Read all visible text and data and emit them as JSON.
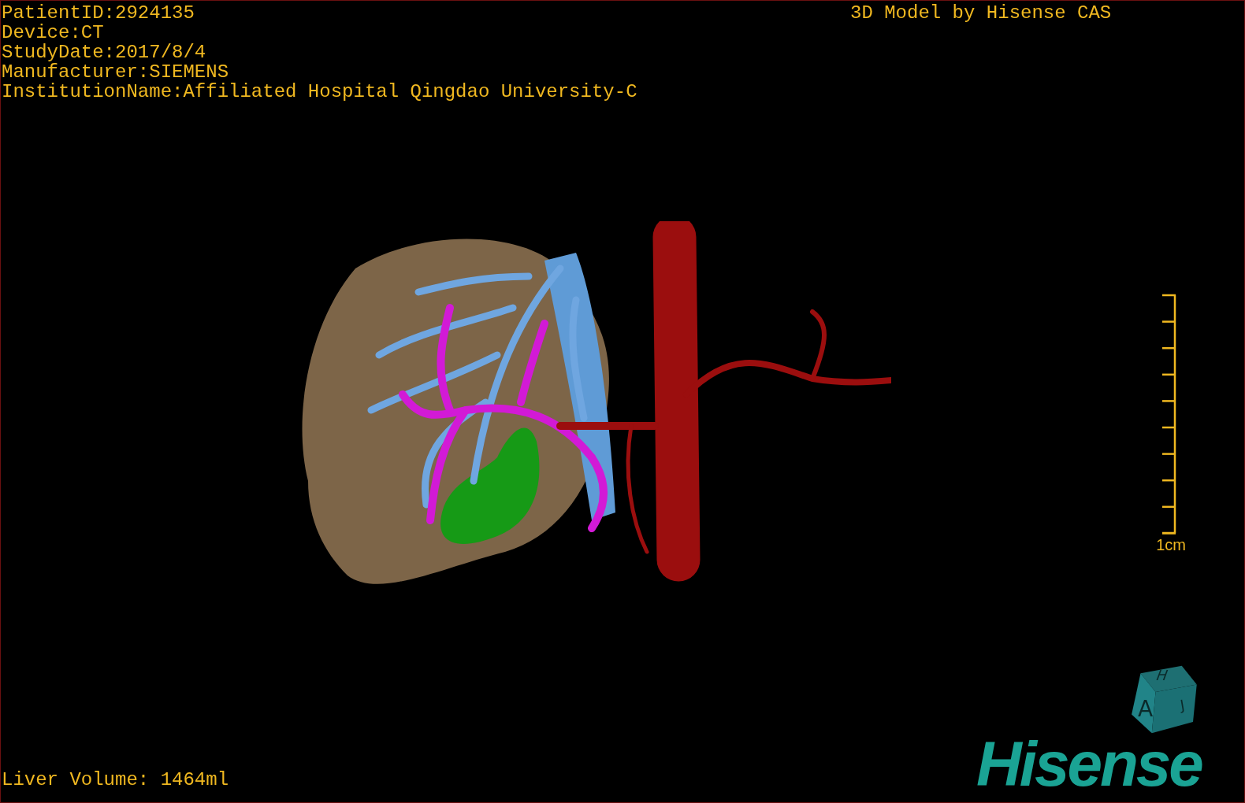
{
  "overlay": {
    "info_lines": [
      "PatientID:2924135",
      "Device:CT",
      "StudyDate:2017/8/4",
      "Manufacturer:SIEMENS",
      "InstitutionName:Affiliated Hospital Qingdao University-C"
    ],
    "title": "3D Model by Hisense CAS",
    "scale_bar": {
      "label": "1cm"
    },
    "measurement": "Liver Volume: 1464ml"
  },
  "orientation_cube": {
    "faces": [
      "H",
      "A",
      "J"
    ]
  },
  "logo": {
    "text": "Hisense"
  }
}
